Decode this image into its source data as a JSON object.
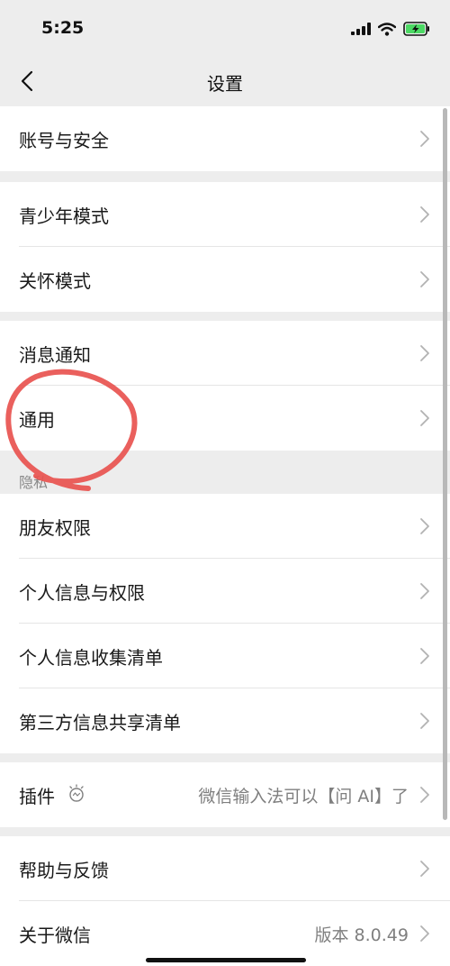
{
  "status_bar": {
    "time": "5:25"
  },
  "nav": {
    "title": "设置"
  },
  "groups": {
    "account": "账号与安全",
    "teen_mode": "青少年模式",
    "care_mode": "关怀模式",
    "notifications": "消息通知",
    "general": "通用",
    "privacy_header": "隐私",
    "friend_permissions": "朋友权限",
    "personal_info_permissions": "个人信息与权限",
    "personal_info_list": "个人信息收集清单",
    "third_party_list": "第三方信息共享清单",
    "plugins": "插件",
    "plugins_value": "微信输入法可以【问 AI】了",
    "help_feedback": "帮助与反馈",
    "about": "关于微信",
    "about_value": "版本 8.0.49"
  },
  "colors": {
    "background": "#ededed",
    "row": "#ffffff",
    "annotation": "#e8534f",
    "battery": "#4cd964"
  }
}
